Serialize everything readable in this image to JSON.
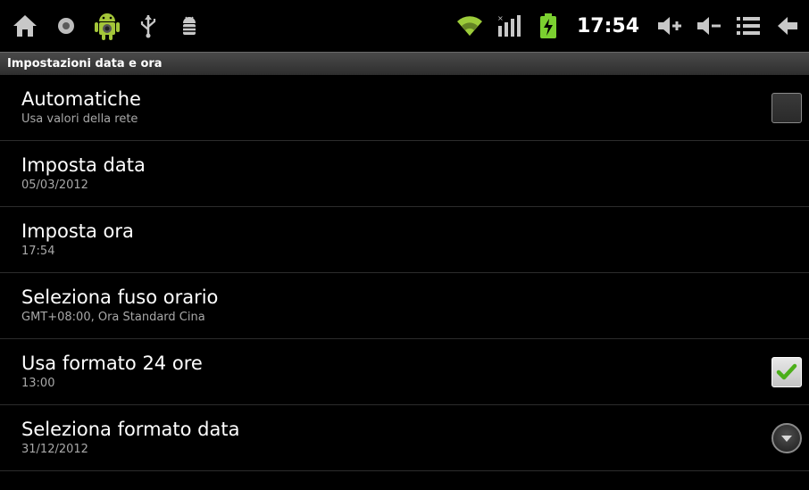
{
  "status_bar": {
    "time": "17:54",
    "left_icons": [
      "home-icon",
      "record-icon",
      "android-icon",
      "usb-icon",
      "debug-icon"
    ],
    "right_icons": [
      "wifi-icon",
      "signal-icon",
      "battery-charging-icon",
      "volume-up-icon",
      "volume-down-icon",
      "menu-icon",
      "back-icon"
    ]
  },
  "title_bar": {
    "title": "Impostazioni data e ora"
  },
  "settings": {
    "items": [
      {
        "title": "Automatiche",
        "summary": "Usa valori della rete",
        "widget": "checkbox",
        "checked": false
      },
      {
        "title": "Imposta data",
        "summary": "05/03/2012",
        "widget": "none"
      },
      {
        "title": "Imposta ora",
        "summary": "17:54",
        "widget": "none"
      },
      {
        "title": "Seleziona fuso orario",
        "summary": "GMT+08:00, Ora Standard Cina",
        "widget": "none"
      },
      {
        "title": "Usa formato 24 ore",
        "summary": "13:00",
        "widget": "checkbox",
        "checked": true
      },
      {
        "title": "Seleziona formato data",
        "summary": "31/12/2012",
        "widget": "dropdown"
      }
    ]
  },
  "colors": {
    "background": "#000000",
    "check_green": "#4caf1a",
    "battery_green": "#7bd030",
    "wifi_green": "#9ccc3a",
    "android_green": "#a4c639"
  }
}
